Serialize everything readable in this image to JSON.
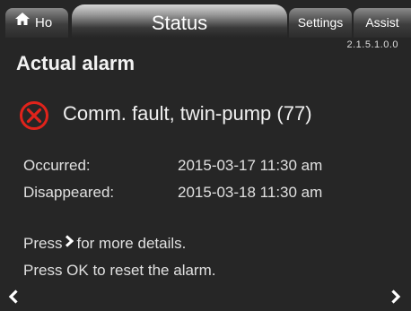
{
  "tabs": {
    "home": "Ho",
    "status": "Status",
    "settings": "Settings",
    "assist": "Assist"
  },
  "version": "2.1.5.1.0.0",
  "page": {
    "title": "Actual alarm"
  },
  "alarm": {
    "icon": "alarm-x-circle-icon",
    "text": "Comm. fault, twin-pump (77)",
    "color": "#e0231b"
  },
  "details": [
    {
      "label": "Occurred:",
      "value": "2015-03-17 11:30 am"
    },
    {
      "label": "Disappeared:",
      "value": "2015-03-18 11:30 am"
    }
  ],
  "hints": {
    "line1_before": "Press",
    "line1_after": "for more details.",
    "line2": "Press OK to reset the alarm."
  },
  "icons": {
    "home": "home-icon",
    "nav_left": "chevron-left-icon",
    "nav_right": "chevron-right-icon"
  }
}
